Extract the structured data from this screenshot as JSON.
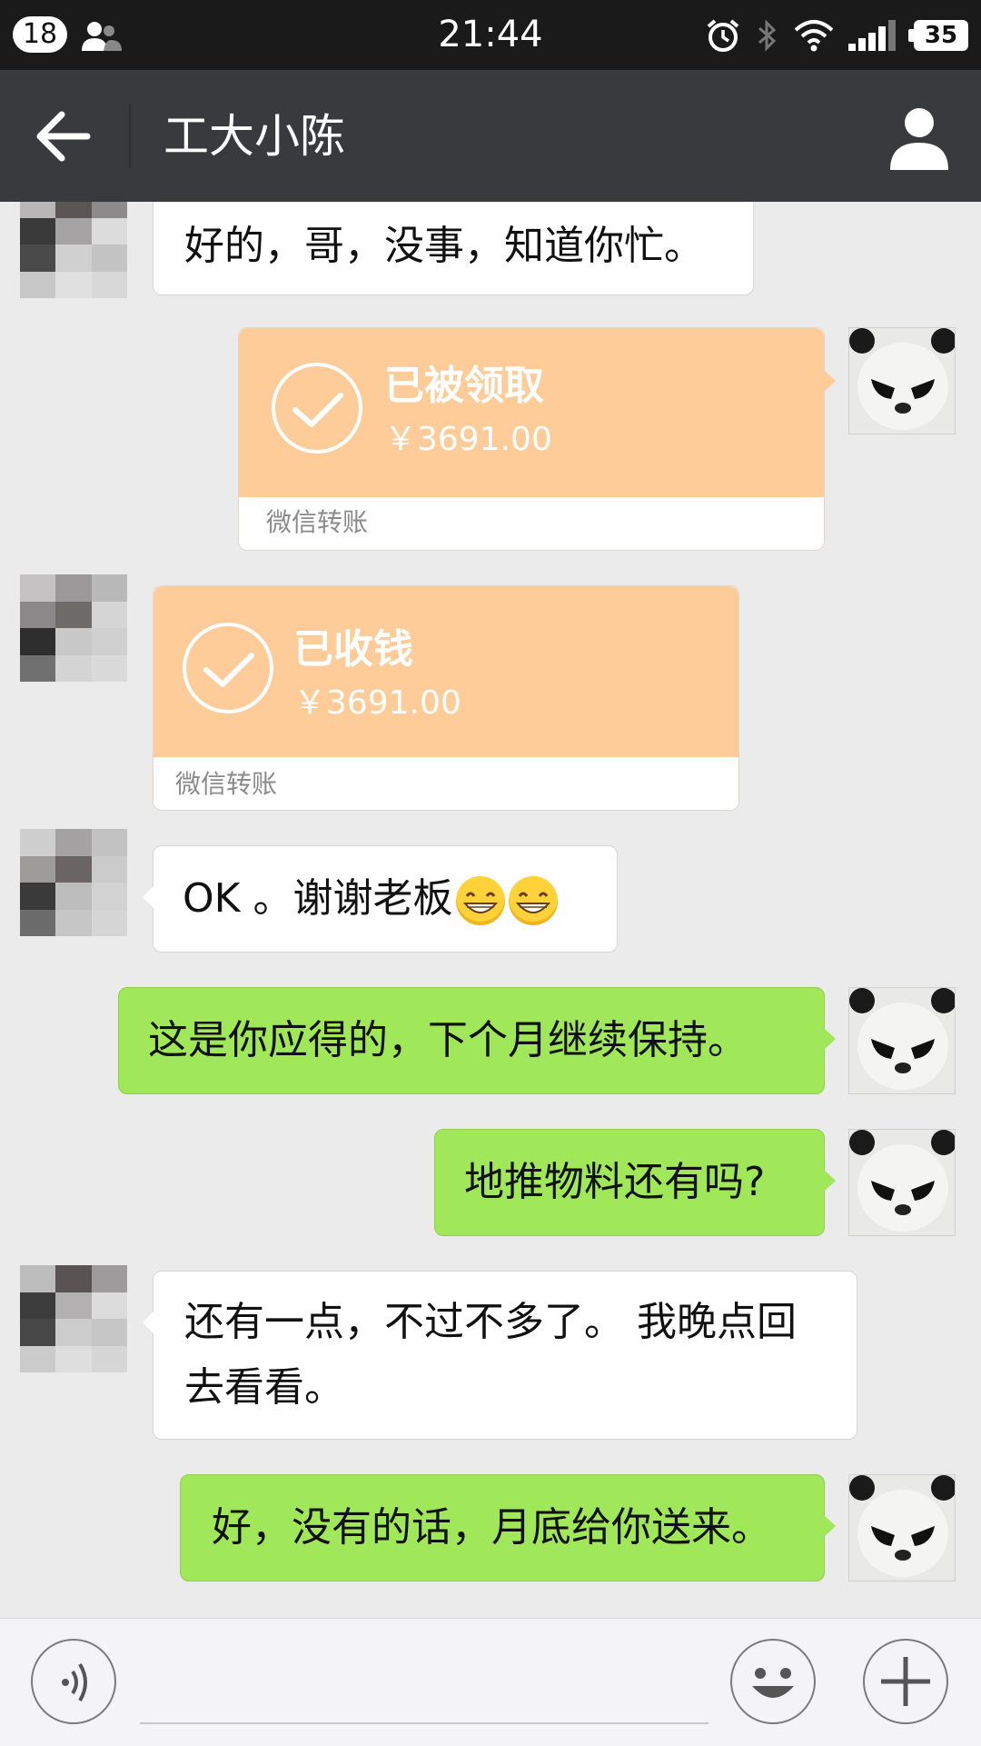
{
  "status_bar": {
    "notification_count": "18",
    "time": "21:44",
    "battery": "35"
  },
  "header": {
    "title": "工大小陈"
  },
  "messages": [
    {
      "side": "left",
      "type": "text",
      "text": "好的，哥，没事，知道你忙。"
    },
    {
      "side": "right",
      "type": "transfer",
      "status": "已被领取",
      "amount": "￥3691.00",
      "footer": "微信转账"
    },
    {
      "side": "left",
      "type": "transfer",
      "status": "已收钱",
      "amount": "￥3691.00",
      "footer": "微信转账"
    },
    {
      "side": "left",
      "type": "text",
      "text": "OK 。谢谢老板"
    },
    {
      "side": "right",
      "type": "text",
      "text": "这是你应得的，下个月继续保持。"
    },
    {
      "side": "right",
      "type": "text",
      "text": "地推物料还有吗?"
    },
    {
      "side": "left",
      "type": "text",
      "text_line1": "还有一点，不过不多了。 我晚点回",
      "text_line2": "去看看。"
    },
    {
      "side": "right",
      "type": "text",
      "text": "好，没有的话，月底给你送来。"
    }
  ],
  "input_bar": {
    "voice_icon": "voice-icon",
    "emoji_icon": "emoji-icon",
    "plus_icon": "plus-icon"
  },
  "colors": {
    "status_bar": "#1a1a1a",
    "title_bar": "#393a3e",
    "chat_bg": "#ebebeb",
    "green_bubble": "#a0e75a",
    "transfer_orange": "#fdcc98"
  }
}
